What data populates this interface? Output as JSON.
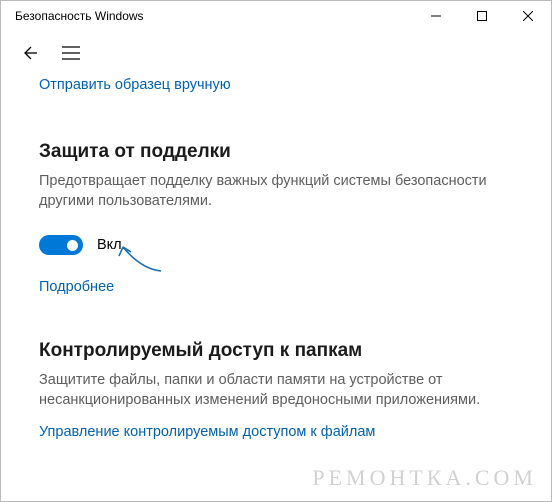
{
  "window": {
    "title": "Безопасность Windows"
  },
  "links": {
    "send_sample": "Отправить образец вручную",
    "learn_more": "Подробнее",
    "manage_cfa": "Управление контролируемым доступом к файлам"
  },
  "tamper": {
    "title": "Защита от подделки",
    "desc": "Предотвращает подделку важных функций системы безопасности другими пользователями.",
    "toggle_state": "Вкл."
  },
  "cfa": {
    "title": "Контролируемый доступ к папкам",
    "desc": "Защитите файлы, папки и области памяти на устройстве от несанкционированных изменений вредоносными приложениями."
  },
  "watermark": "РЕМОНТКА.COM",
  "colors": {
    "accent": "#0078d7",
    "link": "#0062b1"
  }
}
